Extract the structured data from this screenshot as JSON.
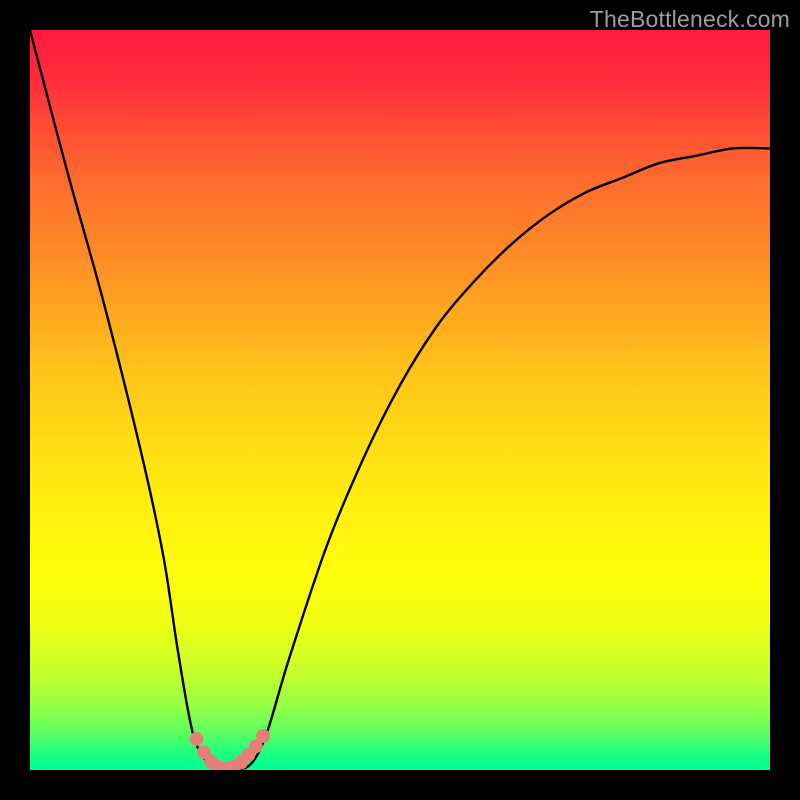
{
  "watermark": "TheBottleneck.com",
  "chart_data": {
    "type": "line",
    "title": "",
    "xlabel": "",
    "ylabel": "",
    "xlim": [
      0,
      100
    ],
    "ylim": [
      0,
      100
    ],
    "series": [
      {
        "name": "bottleneck-curve",
        "x": [
          0,
          5,
          10,
          15,
          18,
          20,
          22,
          24,
          26,
          28,
          30,
          32,
          35,
          40,
          45,
          50,
          55,
          60,
          65,
          70,
          75,
          80,
          85,
          90,
          95,
          100
        ],
        "values": [
          100,
          81,
          63,
          43,
          29,
          16,
          5,
          1,
          0,
          0,
          1,
          5,
          15,
          30,
          42,
          52,
          60,
          66,
          71,
          75,
          78,
          80,
          82,
          83,
          84,
          84
        ]
      }
    ],
    "markers": {
      "name": "highlight-dots",
      "color": "#e58079",
      "x": [
        22.5,
        23.5,
        24.5,
        25.5,
        26.5,
        27.5,
        28.5,
        29.5,
        30.5,
        31.5
      ],
      "values": [
        4.2,
        2.4,
        1.1,
        0.4,
        0.2,
        0.4,
        1.0,
        2.0,
        3.2,
        4.6
      ]
    },
    "gradient_stops": [
      {
        "pos": 0.0,
        "color": "#fe1a3e"
      },
      {
        "pos": 0.3,
        "color": "#ff8a27"
      },
      {
        "pos": 0.6,
        "color": "#ffef0e"
      },
      {
        "pos": 0.85,
        "color": "#ccff29"
      },
      {
        "pos": 1.0,
        "color": "#00ff94"
      }
    ]
  }
}
